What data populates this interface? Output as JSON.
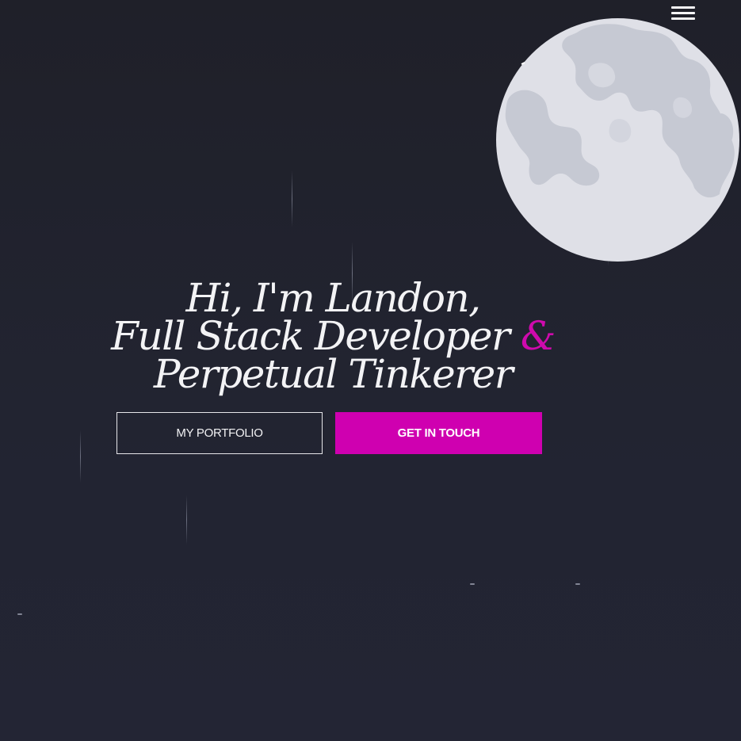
{
  "nav": {
    "menu_icon": "hamburger-menu-icon"
  },
  "decor": {
    "moon_icon": "moon-icon",
    "accent_color": "#cf00b0",
    "background_color": "#21232f"
  },
  "hero": {
    "line1": "Hi, I'm Landon,",
    "line2": "Full Stack Developer",
    "ampersand": "&",
    "line3": "Perpetual Tinkerer"
  },
  "buttons": {
    "portfolio_label": "MY PORTFOLIO",
    "contact_label": "GET IN TOUCH"
  }
}
